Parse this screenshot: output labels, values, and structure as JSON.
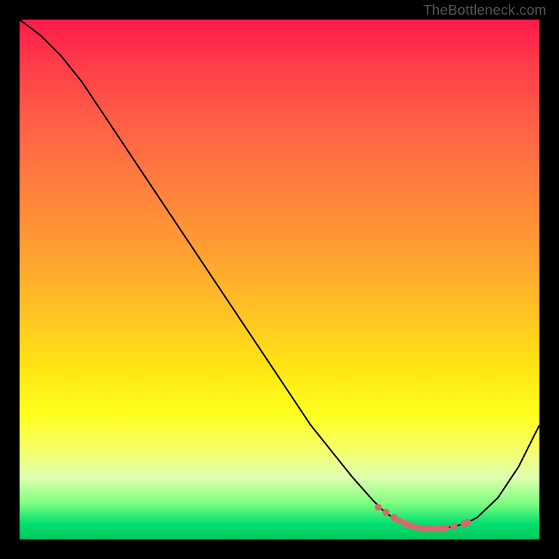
{
  "watermark": "TheBottleneck.com",
  "chart_data": {
    "type": "line",
    "title": "",
    "xlabel": "",
    "ylabel": "",
    "xlim": [
      0,
      100
    ],
    "ylim": [
      0,
      100
    ],
    "series": [
      {
        "name": "curve",
        "x": [
          0,
          4,
          8,
          12,
          16,
          20,
          24,
          28,
          32,
          36,
          40,
          44,
          48,
          52,
          56,
          60,
          64,
          68,
          70,
          72,
          74,
          76,
          78,
          80,
          82,
          84,
          86,
          88,
          92,
          96,
          100
        ],
        "y": [
          100,
          97,
          93,
          88,
          82,
          76,
          70,
          64,
          58,
          52,
          46,
          40,
          34,
          28,
          22,
          17,
          12,
          7.5,
          5.5,
          4,
          3,
          2.3,
          2,
          2,
          2.2,
          2.6,
          3.2,
          4.2,
          8,
          14,
          22
        ]
      }
    ],
    "marker_points": {
      "comment": "pink dotted segment near trough",
      "x": [
        69,
        70.5,
        72,
        73,
        74,
        75,
        76,
        77,
        78,
        79,
        80,
        81,
        82,
        83.5,
        85.5,
        86.2
      ],
      "y": [
        6.2,
        5.2,
        4.2,
        3.6,
        3.1,
        2.7,
        2.4,
        2.2,
        2.1,
        2.05,
        2.05,
        2.1,
        2.2,
        2.5,
        3.0,
        3.3
      ]
    }
  }
}
